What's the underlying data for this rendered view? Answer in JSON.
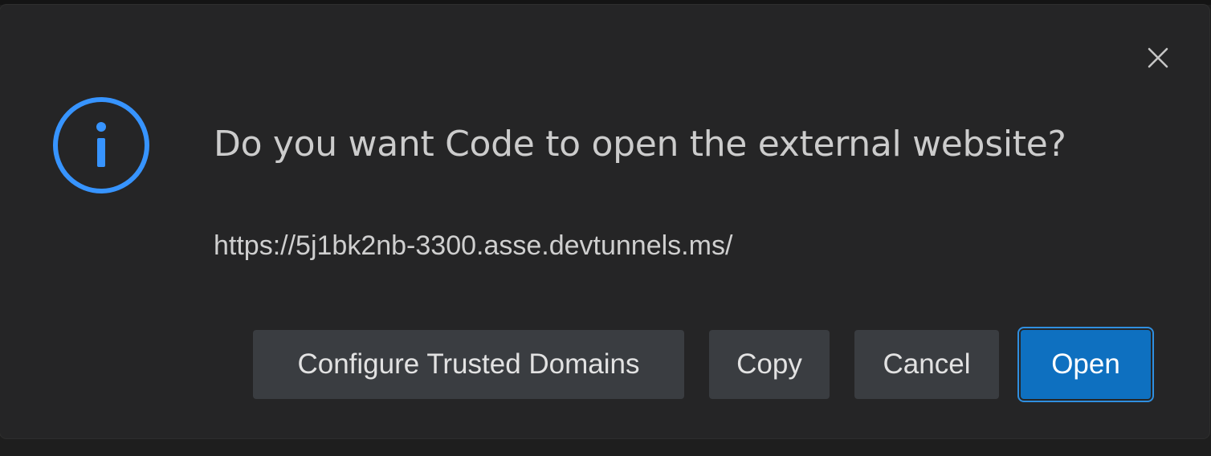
{
  "dialog": {
    "message": "Do you want Code to open the external website?",
    "detail": "https://5j1bk2nb-3300.asse.devtunnels.ms/",
    "icon": "info-icon",
    "close_icon": "close-icon",
    "buttons": {
      "configure_trusted_domains": "Configure Trusted Domains",
      "copy": "Copy",
      "cancel": "Cancel",
      "open": "Open"
    }
  },
  "colors": {
    "info_accent": "#3794ff",
    "primary_button": "#0e70c0",
    "secondary_button": "#3a3d41",
    "dialog_background": "#252526"
  }
}
